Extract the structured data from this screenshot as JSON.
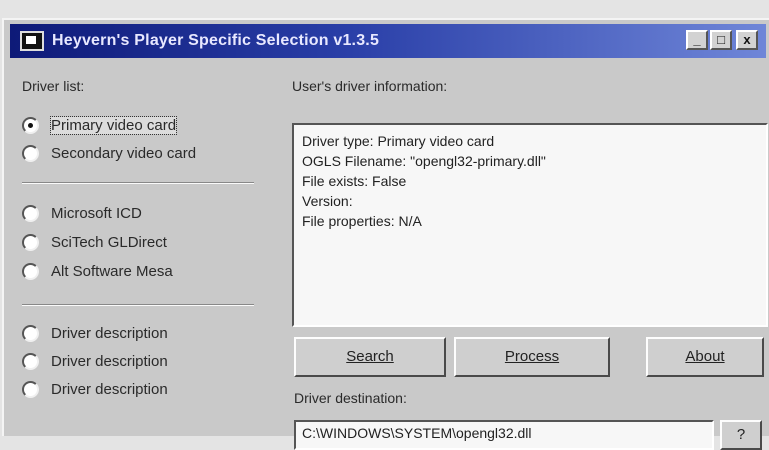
{
  "window": {
    "title": "Heyvern's Player Specific Selection v1.3.5",
    "controls": {
      "minimize": "_",
      "maximize": "□",
      "close": "x"
    }
  },
  "driver_list": {
    "label": "Driver list:",
    "card_options": [
      "Primary video card",
      "Secondary video card"
    ],
    "selected_card": "Primary video card",
    "driver_options": [
      "Microsoft ICD",
      "SciTech GLDirect",
      "Alt Software Mesa"
    ],
    "descriptions": [
      "Driver description",
      "Driver description",
      "Driver description"
    ]
  },
  "user_info": {
    "label": "User's driver information:",
    "lines": [
      "Driver type: Primary video card",
      "OGLS Filename: \"opengl32-primary.dll\"",
      "File exists: False",
      "Version:",
      "File properties: N/A"
    ]
  },
  "buttons": {
    "search": "Search",
    "process": "Process",
    "about": "About",
    "browse": "?"
  },
  "destination": {
    "label": "Driver destination:",
    "value": "C:\\WINDOWS\\SYSTEM\\opengl32.dll"
  },
  "colors": {
    "titlebar_start": "#0e1a78",
    "titlebar_end": "#6f86d8",
    "face": "#c9c9c9"
  }
}
